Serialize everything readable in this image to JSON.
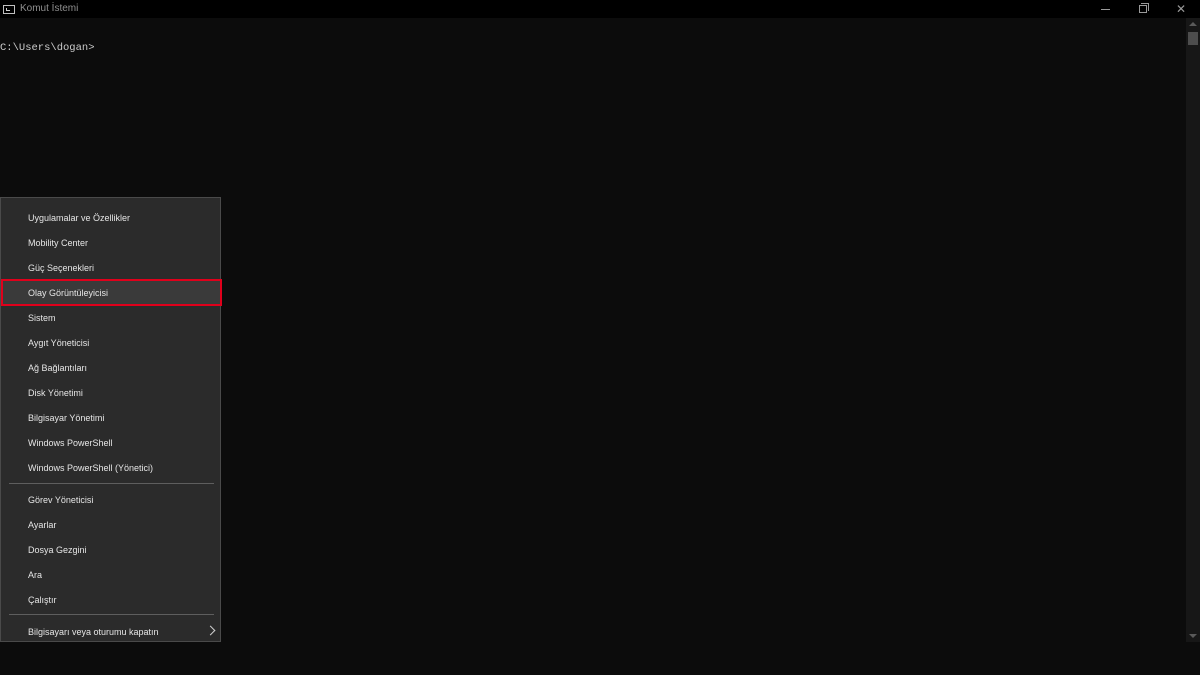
{
  "window": {
    "title": "Komut İstemi",
    "icon": "cmd-icon",
    "controls": [
      "minimize-icon",
      "maximize-icon",
      "close-icon"
    ]
  },
  "console": {
    "prompt": "C:\\Users\\dogan>"
  },
  "menu": {
    "group1": [
      "Uygulamalar ve Özellikler",
      "Mobility Center",
      "Güç Seçenekleri",
      "Olay Görüntüleyicisi",
      "Sistem",
      "Aygıt Yöneticisi",
      "Ağ Bağlantıları",
      "Disk Yönetimi",
      "Bilgisayar Yönetimi",
      "Windows PowerShell",
      "Windows PowerShell (Yönetici)"
    ],
    "group2": [
      "Görev Yöneticisi",
      "Ayarlar",
      "Dosya Gezgini",
      "Ara",
      "Çalıştır"
    ],
    "group3": [
      "Bilgisayarı veya oturumu kapatın"
    ],
    "highlighted_item": "Olay Görüntüleyicisi",
    "highlight_color": "#e0001b",
    "submenu_icon": "chevron-right-icon"
  }
}
